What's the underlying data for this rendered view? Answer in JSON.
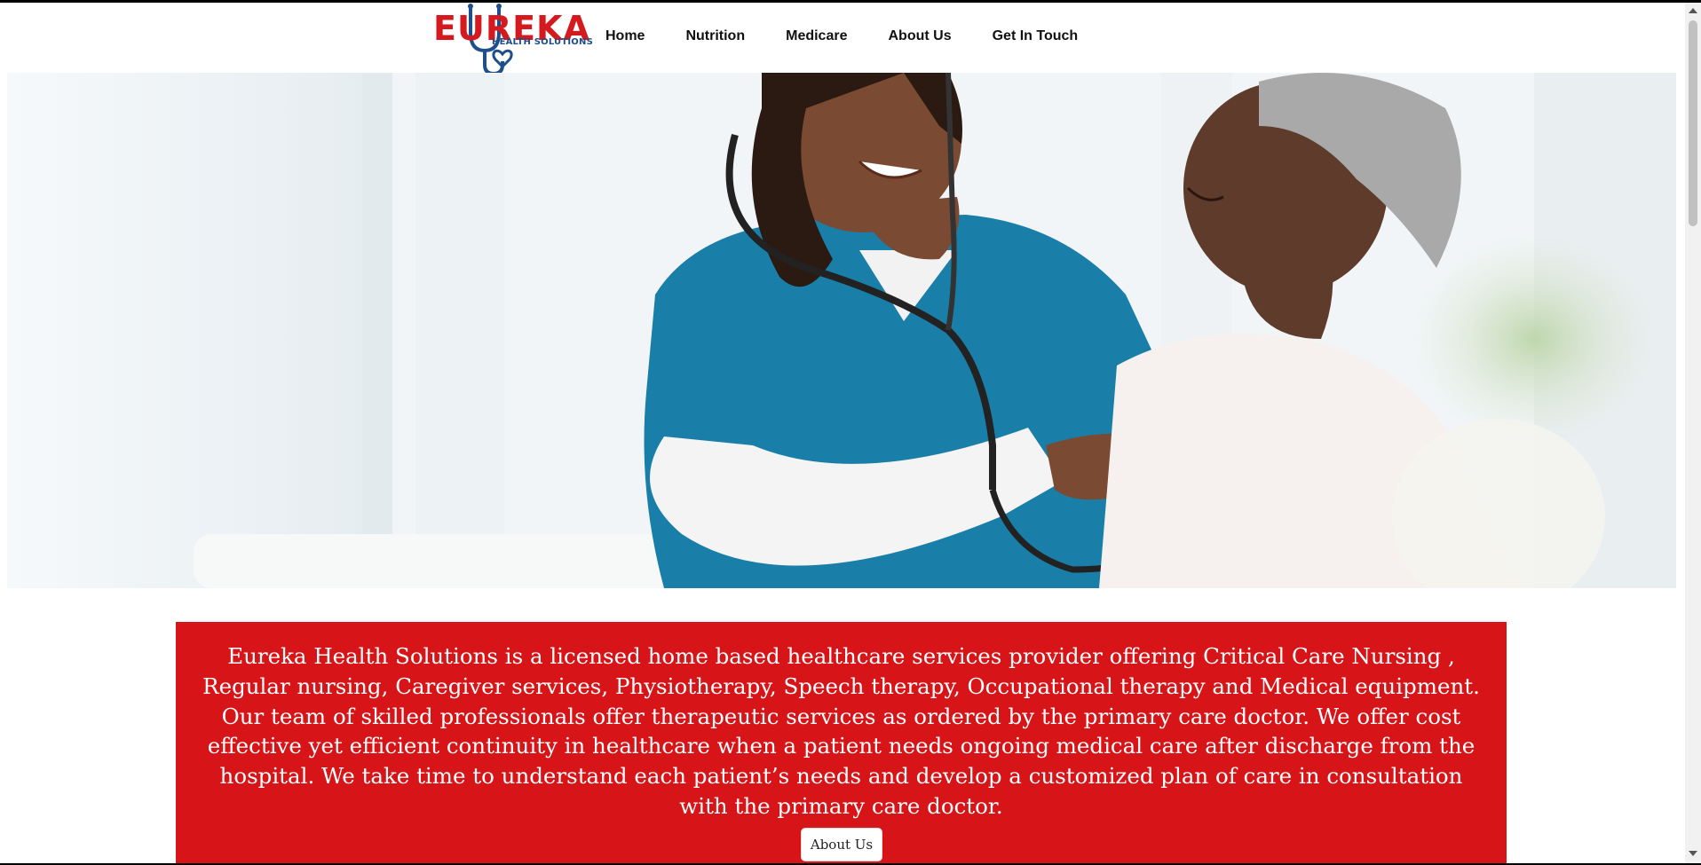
{
  "logo": {
    "word": "EUREKA",
    "tagline": "HEALTH SOLUTIONS",
    "colors": {
      "word": "#d41a1f",
      "tagline": "#1e4f8a"
    }
  },
  "nav": {
    "items": [
      {
        "label": "Home"
      },
      {
        "label": "Nutrition"
      },
      {
        "label": "Medicare"
      },
      {
        "label": "About Us"
      },
      {
        "label": "Get In Touch"
      }
    ]
  },
  "hero": {
    "image_alt": "Smiling nurse in teal scrubs listening to elderly patient's heart with stethoscope"
  },
  "banner": {
    "text": "Eureka Health Solutions is a licensed home based healthcare services provider offering Critical Care Nursing , Regular nursing, Caregiver services, Physiotherapy, Speech therapy, Occupational therapy and Medical equipment. Our team of skilled professionals offer therapeutic services as ordered by the primary care doctor. We offer cost effective yet efficient continuity in healthcare when a patient needs ongoing medical care after discharge from the hospital. We take time to understand each patient’s needs and develop a customized plan of care in consultation with the primary care doctor.",
    "button_label": "About Us",
    "color": "#d71518"
  }
}
